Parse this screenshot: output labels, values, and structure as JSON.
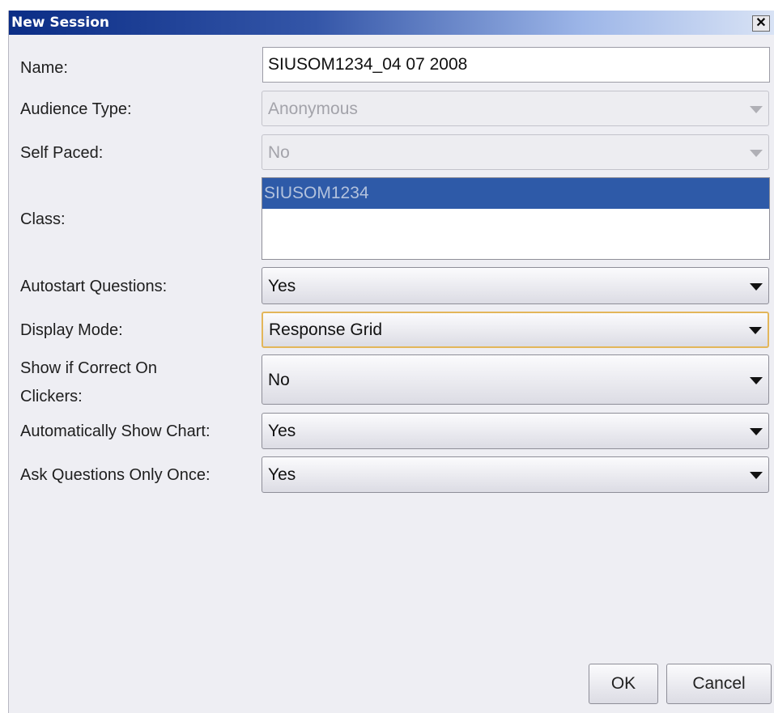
{
  "window": {
    "title": "New Session",
    "close_glyph": "✕"
  },
  "fields": {
    "name": {
      "label": "Name:",
      "value": "SIUSOM1234_04 07 2008"
    },
    "audience_type": {
      "label": "Audience Type:",
      "value": "Anonymous"
    },
    "self_paced": {
      "label": "Self Paced:",
      "value": "No"
    },
    "class": {
      "label": "Class:",
      "items": [
        "SIUSOM1234"
      ]
    },
    "autostart_questions": {
      "label": "Autostart Questions:",
      "value": "Yes"
    },
    "display_mode": {
      "label": "Display Mode:",
      "value": "Response Grid"
    },
    "show_if_correct": {
      "label_line1": "Show if Correct On",
      "label_line2": "Clickers:",
      "value": "No"
    },
    "auto_show_chart": {
      "label": "Automatically Show Chart:",
      "value": "Yes"
    },
    "ask_once": {
      "label": "Ask Questions Only Once:",
      "value": "Yes"
    }
  },
  "buttons": {
    "ok": "OK",
    "cancel": "Cancel"
  },
  "colors": {
    "title_gradient_start": "#0b2d86",
    "selection": "#2e5aa8",
    "focus_border": "#e3b65a"
  },
  "icons": {
    "close": "close-icon",
    "dropdown": "chevron-down-icon"
  }
}
